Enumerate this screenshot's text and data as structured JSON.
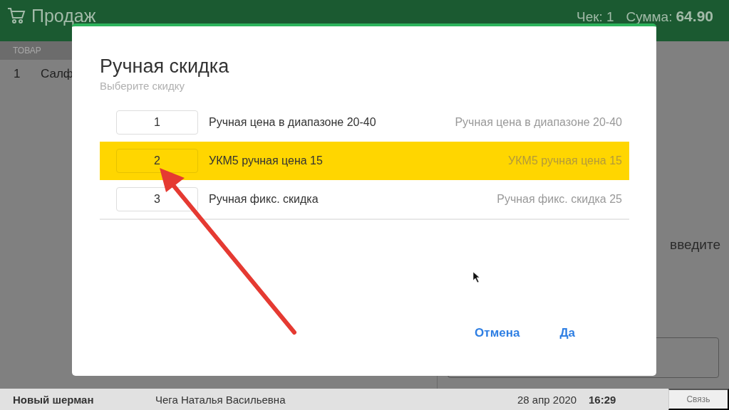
{
  "header": {
    "title": "Продаж",
    "receipt_label": "Чек:",
    "receipt_number": "1",
    "sum_label": "Сумма:",
    "sum": "64.90"
  },
  "table": {
    "columns": [
      "ТОВАР"
    ],
    "rows": [
      {
        "index": "1",
        "name": "Салф"
      }
    ]
  },
  "right_panel": {
    "hint": "введите"
  },
  "dialog": {
    "title": "Ручная скидка",
    "subtitle": "Выберите скидку",
    "options": [
      {
        "number": "1",
        "name": "Ручная цена в диапазоне 20-40",
        "description": "Ручная цена в диапазоне 20-40",
        "selected": false
      },
      {
        "number": "2",
        "name": "УКМ5 ручная цена 15",
        "description": "УКМ5 ручная цена 15",
        "selected": true
      },
      {
        "number": "3",
        "name": "Ручная фикс. скидка",
        "description": "Ручная фикс. скидка 25",
        "selected": false
      }
    ],
    "buttons": [
      "Отмена",
      "Да"
    ]
  },
  "status_bar": {
    "store": "Новый шерман",
    "cashier": "Чега Наталья Васильевна",
    "date": "28 апр 2020",
    "time": "16:29",
    "connection": "Связь"
  }
}
